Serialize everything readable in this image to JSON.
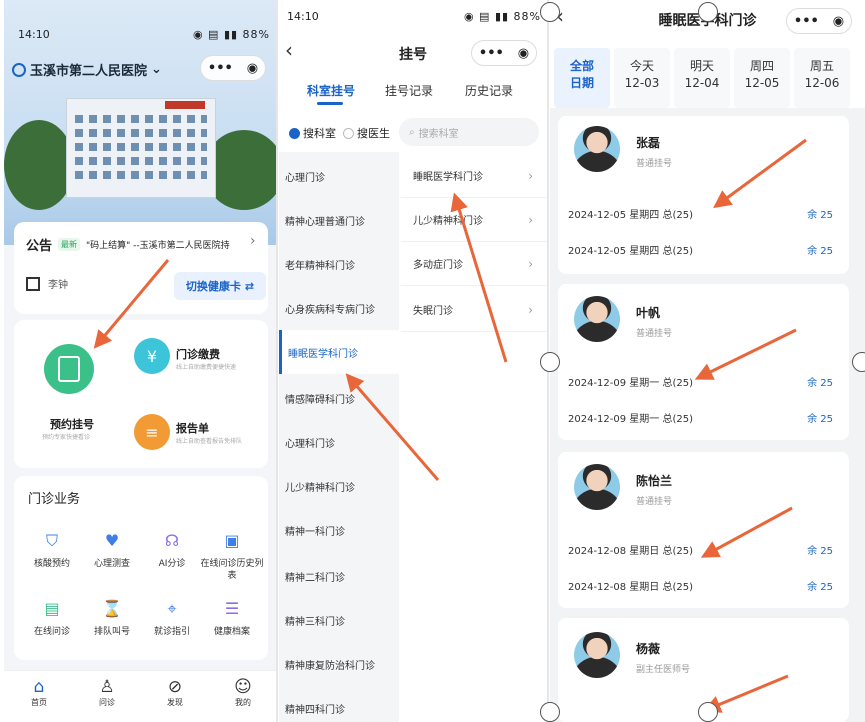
{
  "status": {
    "time": "14:10",
    "battery": "88%"
  },
  "home": {
    "hospital_name": "玉溪市第二人民医院",
    "notice_label": "公告",
    "notice_badge": "最新",
    "notice_text": "\"码上结算\" --玉溪市第二人民医院持",
    "patient_name": "李钟",
    "switch_card": "切换健康卡",
    "services": [
      {
        "title": "预约挂号",
        "sub": "预约专家快捷看诊"
      },
      {
        "title": "门诊缴费",
        "sub": "线上自助缴费便捷快速"
      },
      {
        "title": "报告单",
        "sub": "线上自助查看报告免排队"
      }
    ],
    "section_title": "门诊业务",
    "grid": [
      {
        "label": "核酸预约",
        "icon": "shield-icon"
      },
      {
        "label": "心理测查",
        "icon": "heart-icon"
      },
      {
        "label": "AI分诊",
        "icon": "ai-icon"
      },
      {
        "label": "在线问诊历史列表",
        "icon": "chat-history-icon"
      },
      {
        "label": "在线问诊",
        "icon": "chat-icon"
      },
      {
        "label": "排队叫号",
        "icon": "hourglass-icon"
      },
      {
        "label": "就诊指引",
        "icon": "location-icon"
      },
      {
        "label": "健康档案",
        "icon": "list-icon"
      }
    ],
    "tabs": [
      "首页",
      "问诊",
      "发现",
      "我的"
    ]
  },
  "register": {
    "title": "挂号",
    "tabs": [
      "科室挂号",
      "挂号记录",
      "历史记录"
    ],
    "radio_dept": "搜科室",
    "radio_doctor": "搜医生",
    "search_placeholder": "搜索科室",
    "departments": [
      "心理门诊",
      "精神心理普通门诊",
      "老年精神科门诊",
      "心身疾病科专病门诊",
      "睡眠医学科门诊",
      "情感障碍科门诊",
      "心理科门诊",
      "儿少精神科门诊",
      "精神一科门诊",
      "精神二科门诊",
      "精神三科门诊",
      "精神康复防治科门诊",
      "精神四科门诊"
    ],
    "sub_departments": [
      "睡眠医学科门诊",
      "儿少精神科门诊",
      "多动症门诊",
      "失眠门诊"
    ]
  },
  "schedule": {
    "title": "睡眠医学科门诊",
    "dates": [
      {
        "line1": "全部",
        "line2": "日期"
      },
      {
        "line1": "今天",
        "line2": "12-03"
      },
      {
        "line1": "明天",
        "line2": "12-04"
      },
      {
        "line1": "周四",
        "line2": "12-05"
      },
      {
        "line1": "周五",
        "line2": "12-06"
      }
    ],
    "doctors": [
      {
        "name": "张磊",
        "level": "普通挂号",
        "slots": [
          {
            "text": "2024-12-05 星期四 总(25)",
            "remain": "余 25"
          },
          {
            "text": "2024-12-05 星期四 总(25)",
            "remain": "余 25"
          }
        ]
      },
      {
        "name": "叶帆",
        "level": "普通挂号",
        "slots": [
          {
            "text": "2024-12-09 星期一 总(25)",
            "remain": "余 25"
          },
          {
            "text": "2024-12-09 星期一 总(25)",
            "remain": "余 25"
          }
        ]
      },
      {
        "name": "陈怡兰",
        "level": "普通挂号",
        "slots": [
          {
            "text": "2024-12-08 星期日 总(25)",
            "remain": "余 25"
          },
          {
            "text": "2024-12-08 星期日 总(25)",
            "remain": "余 25"
          }
        ]
      },
      {
        "name": "杨薇",
        "level": "副主任医师号",
        "slots": []
      }
    ]
  },
  "colors": {
    "accent": "#1a64c8",
    "arrow": "#e8663a",
    "green": "#3cc08a",
    "orange": "#f29a33",
    "teal": "#3cc4d8"
  }
}
